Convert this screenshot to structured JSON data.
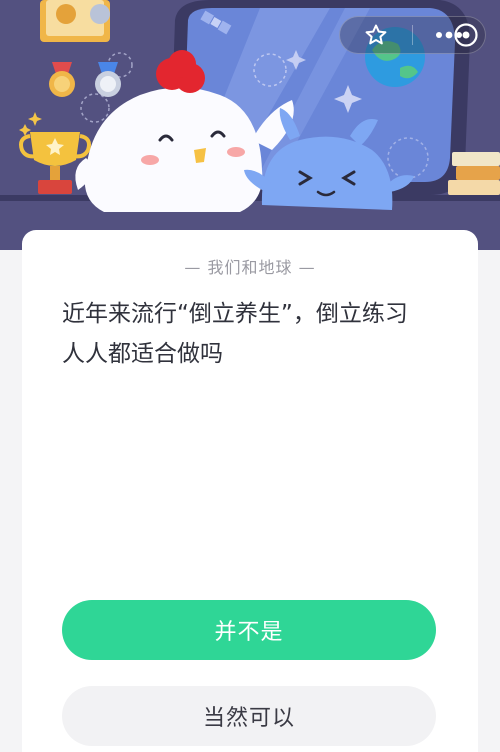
{
  "header": {
    "star_icon": "star-outline-icon",
    "more_icon": "more-dots-icon",
    "close_icon": "close-circle-icon"
  },
  "quiz": {
    "category": "— 我们和地球 —",
    "question_line1": "近年来流行“倒立养生”，倒立练习",
    "question_line2": "人人都适合做吗",
    "options": [
      {
        "label": "并不是"
      },
      {
        "label": "当然可以"
      }
    ]
  },
  "colors": {
    "primary_button": "#2fd696",
    "secondary_button": "#f2f2f4",
    "hero_bg": "#4d4a78"
  }
}
